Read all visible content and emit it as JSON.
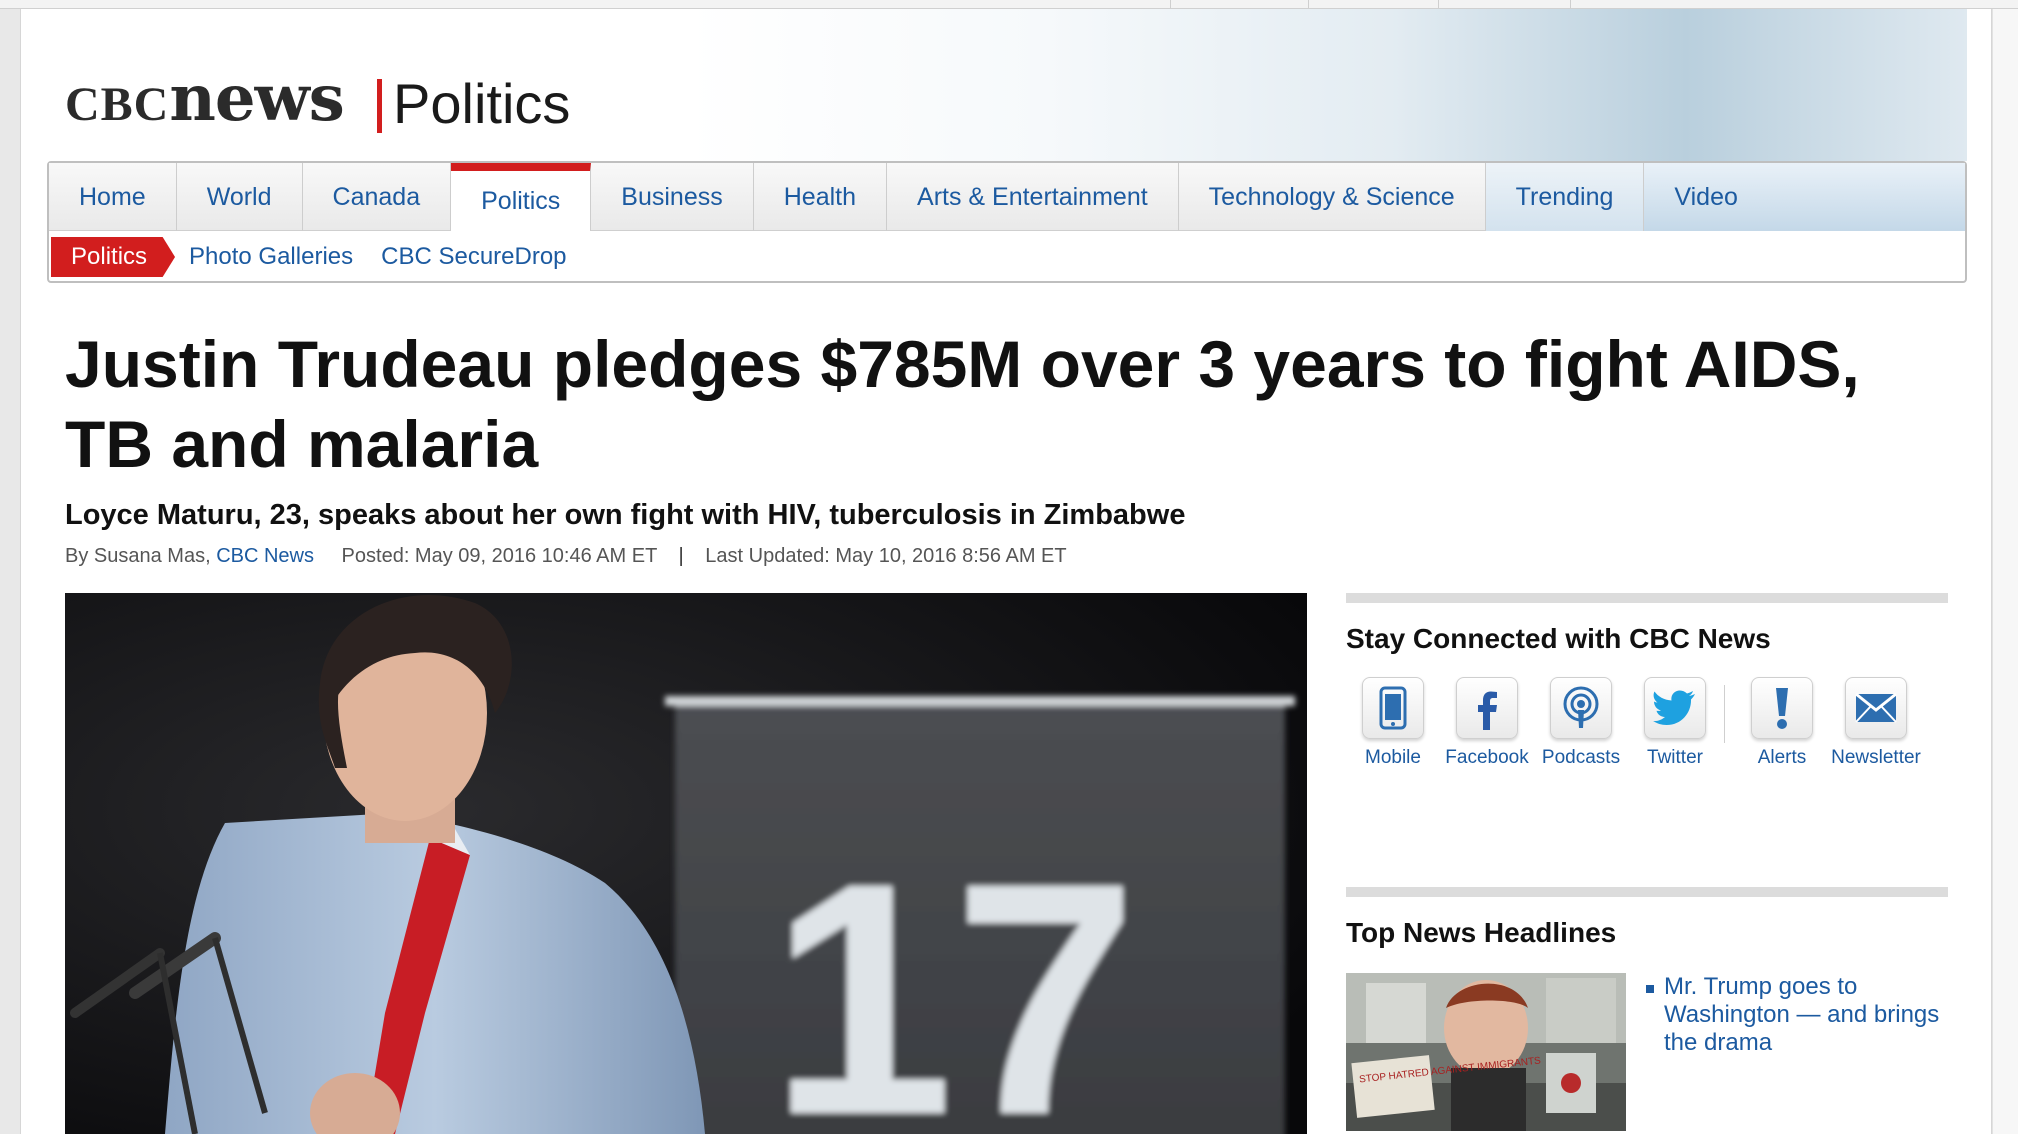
{
  "site": {
    "logo_cbc": "CBC",
    "logo_news": "news",
    "section": "Politics"
  },
  "nav": {
    "tabs": [
      "Home",
      "World",
      "Canada",
      "Politics",
      "Business",
      "Health",
      "Arts & Entertainment",
      "Technology & Science",
      "Trending",
      "Video"
    ],
    "active_tab": "Politics",
    "subnav_current": "Politics",
    "subnav_links": [
      "Photo Galleries",
      "CBC SecureDrop"
    ]
  },
  "article": {
    "headline": "Justin Trudeau pledges $785M over 3 years to fight AIDS, TB and malaria",
    "subheadline": "Loyce Maturu, 23, speaks about her own fight with HIV, tuberculosis in Zimbabwe",
    "byline_prefix": "By Susana Mas,",
    "byline_source": "CBC News",
    "posted": "Posted: May 09, 2016 10:46 AM ET",
    "separator": "|",
    "updated": "Last Updated: May 10, 2016 8:56 AM ET",
    "photo_sign_number": "17"
  },
  "sidebar": {
    "connect_title": "Stay Connected with CBC News",
    "social": [
      {
        "label": "Mobile",
        "icon": "mobile-icon"
      },
      {
        "label": "Facebook",
        "icon": "facebook-icon"
      },
      {
        "label": "Podcasts",
        "icon": "podcast-icon"
      },
      {
        "label": "Twitter",
        "icon": "twitter-icon"
      },
      {
        "label": "Alerts",
        "icon": "alert-icon"
      },
      {
        "label": "Newsletter",
        "icon": "envelope-icon"
      }
    ],
    "top_news_title": "Top News Headlines",
    "top_news": [
      {
        "title": "Mr. Trump goes to Washington — and brings the drama",
        "thumb_sign": "STOP HATRED AGAINST IMMIGRANTS"
      }
    ]
  },
  "colors": {
    "accent_red": "#d21e1e",
    "link_blue": "#1c5aa0"
  }
}
